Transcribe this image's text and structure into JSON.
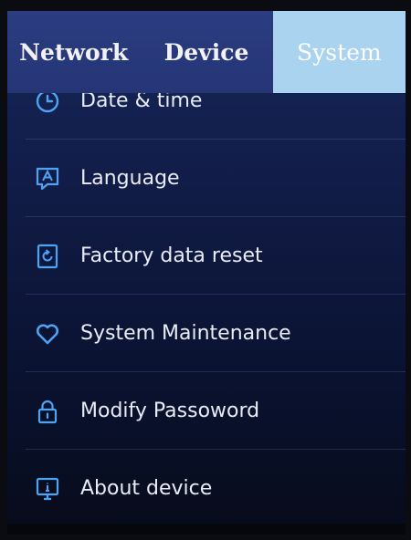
{
  "tabs": [
    {
      "label": "Network",
      "active": false
    },
    {
      "label": "Device",
      "active": false
    },
    {
      "label": "System",
      "active": true
    }
  ],
  "menu": {
    "items": [
      {
        "label": "Date & time",
        "icon": "clock-icon"
      },
      {
        "label": "Language",
        "icon": "language-icon"
      },
      {
        "label": "Factory data reset",
        "icon": "factory-reset-icon"
      },
      {
        "label": "System Maintenance",
        "icon": "heart-icon"
      },
      {
        "label": "Modify Passoword",
        "icon": "lock-icon"
      },
      {
        "label": "About device",
        "icon": "info-monitor-icon"
      }
    ]
  },
  "colors": {
    "accent": "#4ea3f2",
    "active_tab": "#a9d3ee",
    "tab_bar": "#2b3c80",
    "background": "#101b44"
  }
}
